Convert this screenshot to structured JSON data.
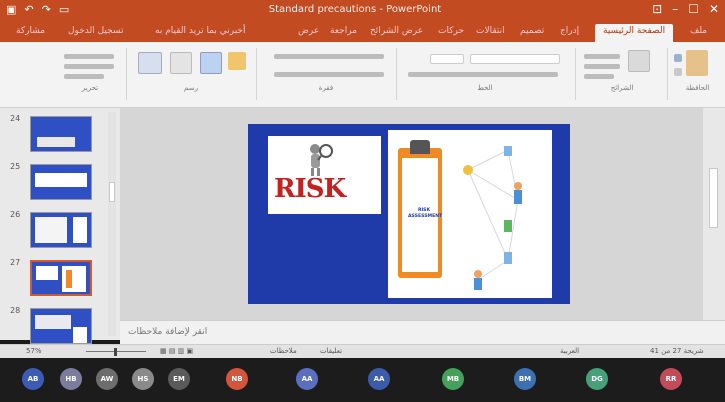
{
  "window": {
    "title": "Standard precautions - PowerPoint"
  },
  "ribbon": {
    "tabs": [
      "ملف",
      "الصفحة الرئيسية",
      "إدراج",
      "تصميم",
      "انتقالات",
      "حركات",
      "عرض الشرائح",
      "مراجعة",
      "عرض",
      "أخبرني بما تريد القيام به",
      "تسجيل الدخول",
      "مشاركة"
    ],
    "active_tab": "الصفحة الرئيسية",
    "group_labels": [
      "الحافظة",
      "الشرائح",
      "الخط",
      "فقرة",
      "رسم",
      "تحرير"
    ]
  },
  "thumbnails": {
    "numbers": [
      "24",
      "25",
      "26",
      "27",
      "28"
    ],
    "selected": "27"
  },
  "slide": {
    "risk_text": "RISK",
    "clipboard_text": "RISK ASSESSMENT"
  },
  "notes": {
    "placeholder": "انقر لإضافة ملاحظات"
  },
  "status": {
    "slide_info": "شريحة 27 من 41",
    "language": "العربية",
    "notes_label": "ملاحظات",
    "comments_label": "تعليقات",
    "zoom": "57%"
  },
  "participants": [
    {
      "initials": "AB",
      "color": "#3b5bb5"
    },
    {
      "initials": "HB",
      "color": "#7c7c9c"
    },
    {
      "initials": "AW",
      "color": "#6d6d6d"
    },
    {
      "initials": "HS",
      "color": "#8a8a8a"
    },
    {
      "initials": "EM",
      "color": "#5a5a5a"
    },
    {
      "initials": "NB",
      "color": "#d2553c"
    },
    {
      "initials": "AA",
      "color": "#5a6fbf"
    },
    {
      "initials": "AA",
      "color": "#3c5ba8"
    },
    {
      "initials": "MB",
      "color": "#44a05a"
    },
    {
      "initials": "BM",
      "color": "#3c70b0"
    },
    {
      "initials": "DG",
      "color": "#46a07a"
    },
    {
      "initials": "RR",
      "color": "#c24b5a"
    }
  ],
  "colors": {
    "accent": "#c24b22",
    "slide_bg": "#1f3aa9",
    "risk_red": "#c62020",
    "clipboard": "#f08a24"
  }
}
